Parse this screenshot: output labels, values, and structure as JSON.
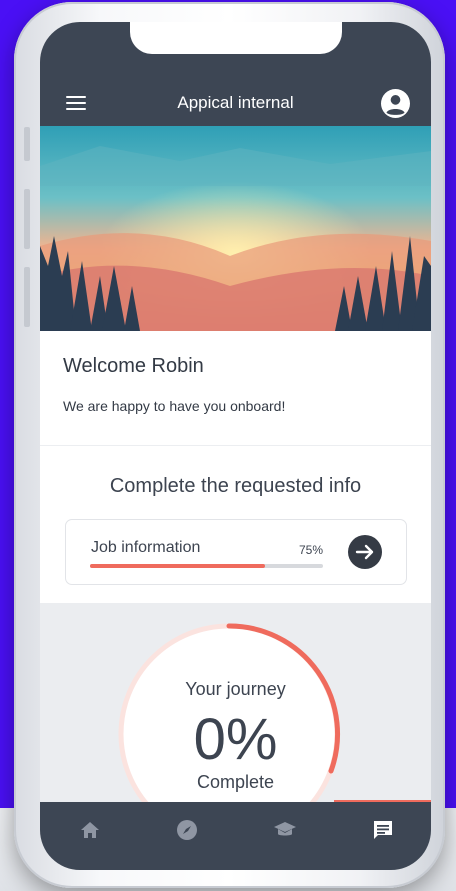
{
  "header": {
    "title": "Appical internal"
  },
  "welcome": {
    "greeting": "Welcome Robin",
    "message": "We are happy to have you onboard!"
  },
  "requested_info": {
    "title": "Complete the requested info",
    "items": [
      {
        "label": "Job information",
        "percent_text": "75%",
        "progress": 0.75
      }
    ]
  },
  "journey": {
    "title": "Your journey",
    "percent": "0%",
    "caption": "Complete"
  },
  "nav": [
    "home-icon",
    "compass-icon",
    "graduation-cap-icon",
    "chat-icon"
  ],
  "colors": {
    "header_bg": "#3d4654",
    "accent": "#ef6b5d",
    "background": "#4a10f5"
  }
}
